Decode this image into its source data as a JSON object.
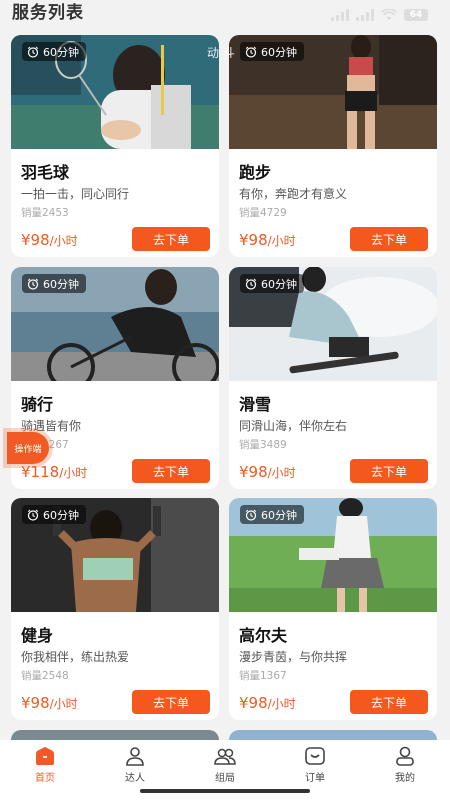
{
  "header": {
    "title": "服务列表"
  },
  "status_bar": {
    "battery": "64"
  },
  "watermark": "动 斗",
  "operator_badge": "操作端",
  "services": [
    {
      "title": "羽毛球",
      "desc": "一拍一击，同心同行",
      "sales": "销量2453",
      "price": "¥98",
      "unit": "/小时",
      "duration": "60分钟",
      "button": "去下单"
    },
    {
      "title": "跑步",
      "desc": "有你，奔跑才有意义",
      "sales": "销量4729",
      "price": "¥98",
      "unit": "/小时",
      "duration": "60分钟",
      "button": "去下单"
    },
    {
      "title": "骑行",
      "desc": "骑遇皆有你",
      "sales": "销量3267",
      "price": "¥118",
      "unit": "/小时",
      "duration": "60分钟",
      "button": "去下单"
    },
    {
      "title": "滑雪",
      "desc": "同滑山海，伴你左右",
      "sales": "销量3489",
      "price": "¥98",
      "unit": "/小时",
      "duration": "60分钟",
      "button": "去下单"
    },
    {
      "title": "健身",
      "desc": "你我相伴，练出热爱",
      "sales": "销量2548",
      "price": "¥98",
      "unit": "/小时",
      "duration": "60分钟",
      "button": "去下单"
    },
    {
      "title": "高尔夫",
      "desc": "漫步青茵，与你共挥",
      "sales": "销量1367",
      "price": "¥98",
      "unit": "/小时",
      "duration": "60分钟",
      "button": "去下单"
    }
  ],
  "tabs": [
    {
      "label": "首页",
      "icon": "home-icon",
      "active": true
    },
    {
      "label": "达人",
      "icon": "person-icon",
      "active": false
    },
    {
      "label": "组局",
      "icon": "group-icon",
      "active": false
    },
    {
      "label": "订单",
      "icon": "order-icon",
      "active": false
    },
    {
      "label": "我的",
      "icon": "profile-icon",
      "active": false
    }
  ],
  "colors": {
    "accent": "#f15a24",
    "background": "#f2f2f2"
  }
}
